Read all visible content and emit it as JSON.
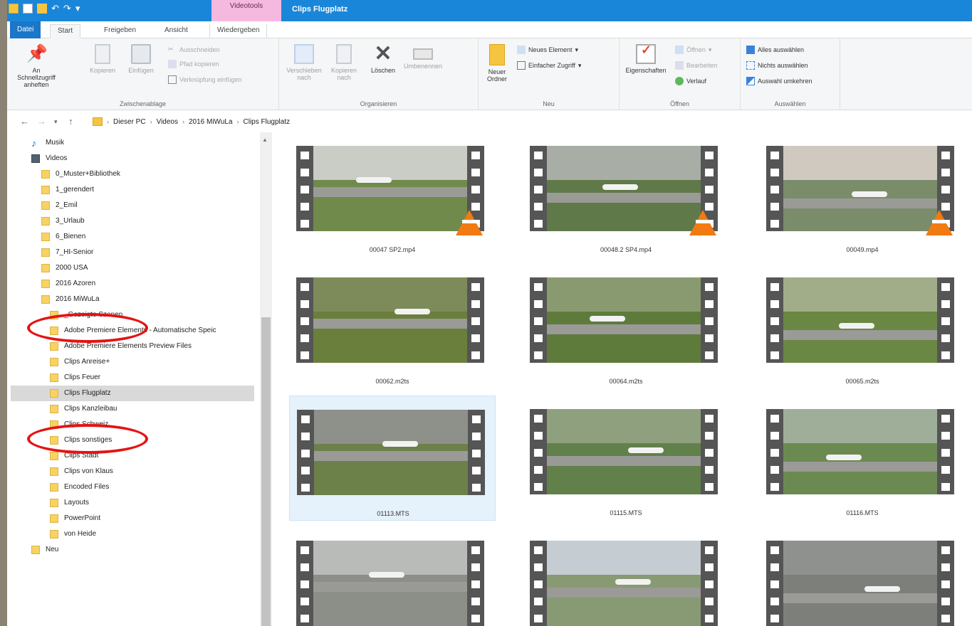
{
  "titlebar": {
    "context_group": "Videotools",
    "title": "Clips Flugplatz"
  },
  "tabs": [
    "Datei",
    "Start",
    "Freigeben",
    "Ansicht",
    "Wiedergeben"
  ],
  "ribbon": {
    "clipboard": {
      "pin_label": "An Schnellzugriff anheften",
      "copy": "Kopieren",
      "paste": "Einfügen",
      "cut": "Ausschneiden",
      "copy_path": "Pfad kopieren",
      "paste_shortcut": "Verknüpfung einfügen",
      "group": "Zwischenablage"
    },
    "organize": {
      "move": "Verschieben nach",
      "copy_to": "Kopieren nach",
      "delete": "Löschen",
      "rename": "Umbenennen",
      "group": "Organisieren"
    },
    "new": {
      "new_folder": "Neuer Ordner",
      "new_item": "Neues Element",
      "easy_access": "Einfacher Zugriff",
      "group": "Neu"
    },
    "open": {
      "properties": "Eigenschaften",
      "open": "Öffnen",
      "edit": "Bearbeiten",
      "history": "Verlauf",
      "group": "Öffnen"
    },
    "select": {
      "select_all": "Alles auswählen",
      "select_none": "Nichts auswählen",
      "invert": "Auswahl umkehren",
      "group": "Auswählen"
    }
  },
  "breadcrumb": [
    "Dieser PC",
    "Videos",
    "2016 MiWuLa",
    "Clips Flugplatz"
  ],
  "navpane": {
    "top": [
      {
        "label": "Musik",
        "icon": "music-icon"
      },
      {
        "label": "Videos",
        "icon": "video-library-icon"
      }
    ],
    "level1": [
      "0_Muster+Bibliothek",
      "1_gerendert",
      "2_Emil",
      "3_Urlaub",
      "6_Bienen",
      "7_HI-Senior",
      "2000 USA",
      "2016 Azoren",
      "2016 MiWuLa"
    ],
    "level2": [
      "_Gezeigte Szenen",
      "Adobe Premiere Elements - Automatische Speic",
      "Adobe Premiere Elements Preview Files",
      "Clips Anreise+",
      "Clips Feuer",
      "Clips Flugplatz",
      "Clips Kanzleibau",
      "Clips Schweiz",
      "Clips sonstiges",
      "Clips Stadt",
      "Clips von Klaus",
      "Encoded Files",
      "Layouts",
      "PowerPoint",
      "von Heide"
    ],
    "after": [
      "Neu"
    ],
    "selected": "Clips Flugplatz"
  },
  "files": [
    {
      "name": "00047 SP2.mp4",
      "vlc": true,
      "selected": false
    },
    {
      "name": "00048.2 SP4.mp4",
      "vlc": true,
      "selected": false
    },
    {
      "name": "00049.mp4",
      "vlc": true,
      "selected": false
    },
    {
      "name": "00062.m2ts",
      "vlc": false,
      "selected": false
    },
    {
      "name": "00064.m2ts",
      "vlc": false,
      "selected": false
    },
    {
      "name": "00065.m2ts",
      "vlc": false,
      "selected": false
    },
    {
      "name": "01113.MTS",
      "vlc": false,
      "selected": true
    },
    {
      "name": "01115.MTS",
      "vlc": false,
      "selected": false
    },
    {
      "name": "01116.MTS",
      "vlc": false,
      "selected": false
    },
    {
      "name": "",
      "vlc": false,
      "selected": false
    },
    {
      "name": "",
      "vlc": false,
      "selected": false
    },
    {
      "name": "",
      "vlc": false,
      "selected": false
    }
  ],
  "colors": {
    "titlebar": "#1a86d9",
    "context_tab": "#f5b8de",
    "annotation": "#e31414",
    "selection": "#e5f1fb"
  }
}
